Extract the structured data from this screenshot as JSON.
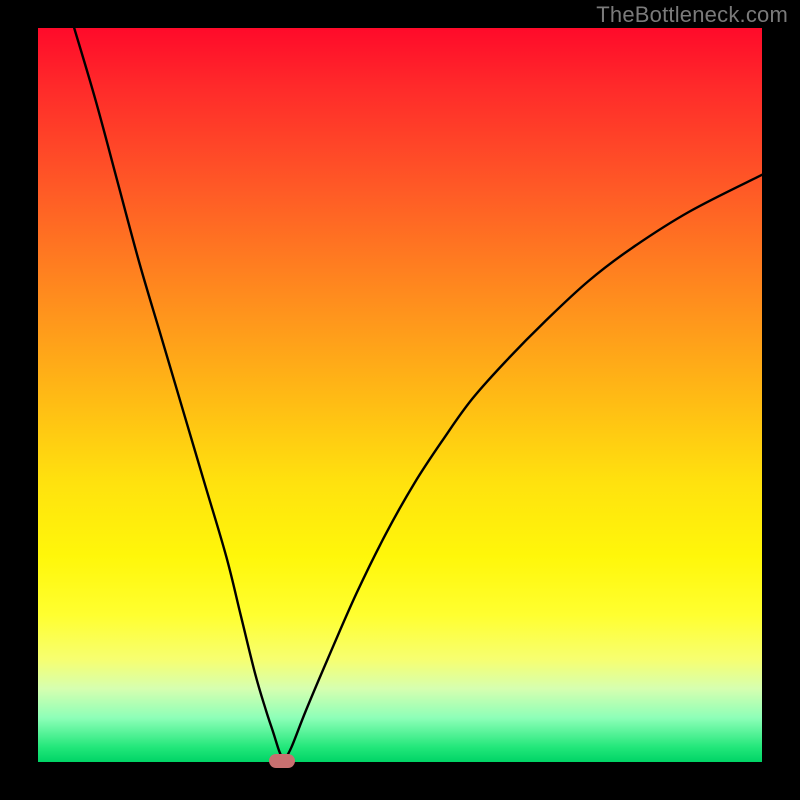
{
  "watermark": "TheBottleneck.com",
  "chart_data": {
    "type": "line",
    "title": "",
    "xlabel": "",
    "ylabel": "",
    "xlim": [
      0,
      100
    ],
    "ylim": [
      0,
      100
    ],
    "grid": false,
    "series": [
      {
        "name": "curve",
        "color": "#000000",
        "x": [
          5,
          8,
          11,
          14,
          17,
          20,
          23,
          26,
          28,
          30,
          31.5,
          32.5,
          33.2,
          33.6,
          33.8,
          34,
          35,
          37,
          40,
          44,
          48,
          52,
          56,
          60,
          65,
          70,
          76,
          82,
          90,
          100
        ],
        "y": [
          100,
          90,
          79,
          68,
          58,
          48,
          38,
          28,
          20,
          12,
          7,
          4,
          1.8,
          0.8,
          0.3,
          0.3,
          2,
          7,
          14,
          23,
          31,
          38,
          44,
          49.5,
          55,
          60,
          65.5,
          70,
          75,
          80
        ]
      }
    ],
    "marker": {
      "x": 33.7,
      "y": 0.2,
      "color": "#c87070"
    }
  }
}
